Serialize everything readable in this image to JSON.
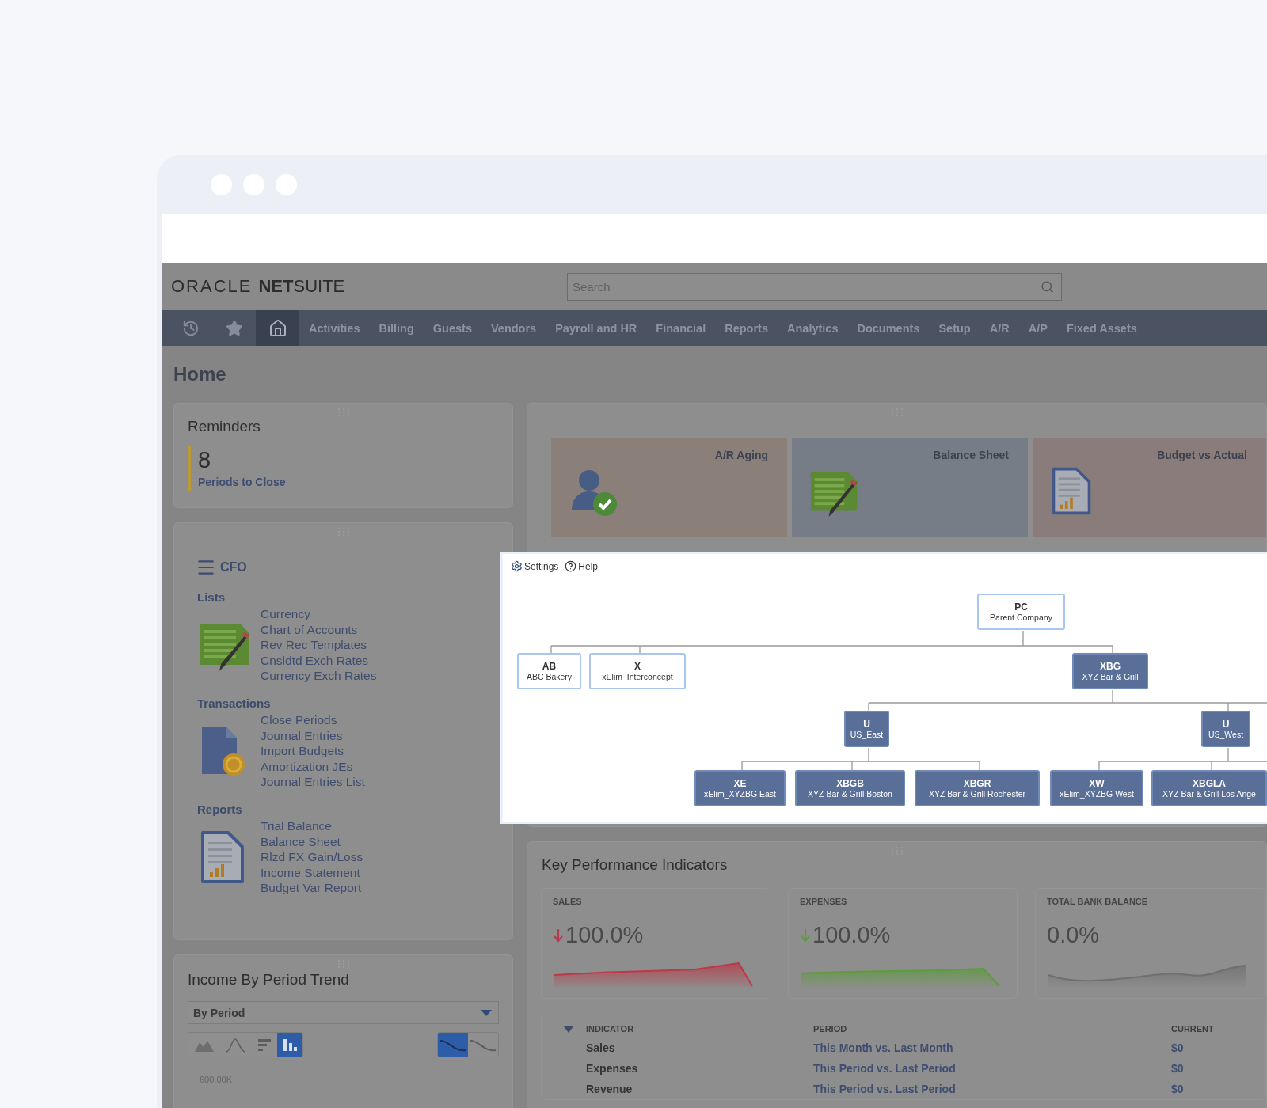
{
  "header": {
    "logo": {
      "brand": "ORACLE",
      "product": "**NET**SUITE"
    },
    "search": {
      "placeholder": "Search"
    }
  },
  "nav": {
    "shortcuts": [
      {
        "selected": false
      },
      {
        "selected": false
      },
      {
        "selected": true
      }
    ],
    "items": [
      {
        "label": "Activities",
        "selected": false
      },
      {
        "label": "Billing",
        "selected": false
      },
      {
        "label": "Guests",
        "selected": false
      },
      {
        "label": "Vendors",
        "selected": false
      },
      {
        "label": "Payroll and HR",
        "selected": false
      },
      {
        "label": "Financial",
        "selected": false
      },
      {
        "label": "Reports",
        "selected": false
      },
      {
        "label": "Analytics",
        "selected": false
      },
      {
        "label": "Documents",
        "selected": false
      },
      {
        "label": "Setup",
        "selected": false
      },
      {
        "label": "A/R",
        "selected": false
      },
      {
        "label": "A/P",
        "selected": false
      },
      {
        "label": "Fixed Assets",
        "selected": false
      }
    ]
  },
  "page_title": "Home",
  "reminders": {
    "title": "Reminders",
    "items": [
      {
        "count": "8",
        "label": "Periods to Close"
      }
    ]
  },
  "cfo": {
    "title": "CFO",
    "sections": [
      {
        "heading": "Lists",
        "links": [
          "Currency",
          "Chart of Accounts",
          "Rev Rec Templates",
          "Cnsldtd Exch Rates",
          "Currency Exch Rates"
        ]
      },
      {
        "heading": "Transactions",
        "links": [
          "Close Periods",
          "Journal Entries",
          "Import Budgets",
          "Amortization JEs",
          "Journal Entries List"
        ]
      },
      {
        "heading": "Reports",
        "links": [
          "Trial Balance",
          "Balance Sheet",
          "Rlzd FX Gain/Loss",
          "Income Statement",
          "Budget Var Report"
        ]
      }
    ]
  },
  "income_trend": {
    "title": "Income By Period Trend",
    "dropdown": "By Period",
    "chart_types": [
      {
        "selected": false
      },
      {
        "selected": false
      },
      {
        "selected": false
      },
      {
        "selected": true
      }
    ],
    "line_styles": [
      {
        "selected": true
      },
      {
        "selected": false
      }
    ],
    "axis_label": "600.00K"
  },
  "shortcut_tiles": [
    {
      "label": "A/R Aging",
      "color": "#8b7f79"
    },
    {
      "label": "Balance Sheet",
      "color": "#767d87"
    },
    {
      "label": "Budget vs Actual",
      "color": "#8b7c7c"
    }
  ],
  "org_chart": {
    "toolbar": [
      {
        "label": "Settings"
      },
      {
        "label": "Help"
      }
    ],
    "root": {
      "code": "PC",
      "name": "Parent Company",
      "kind": "outline",
      "children": [
        {
          "code": "AB",
          "name": "ABC Bakery",
          "kind": "outline"
        },
        {
          "code": "X",
          "name": "xElim_Interconcept",
          "kind": "outline"
        },
        {
          "code": "XBG",
          "name": "XYZ Bar & Grill",
          "kind": "filled",
          "children": [
            {
              "code": "U",
              "name": "US_East",
              "kind": "filled",
              "children": [
                {
                  "code": "XE",
                  "name": "xElim_XYZBG East",
                  "kind": "filled"
                },
                {
                  "code": "XBGB",
                  "name": "XYZ Bar & Grill Boston",
                  "kind": "filled"
                },
                {
                  "code": "XBGR",
                  "name": "XYZ Bar & Grill Rochester",
                  "kind": "filled"
                }
              ]
            },
            {
              "code": "U",
              "name": "US_West",
              "kind": "filled",
              "children": [
                {
                  "code": "XW",
                  "name": "xElim_XYZBG West",
                  "kind": "filled"
                },
                {
                  "code": "XBGLA",
                  "name": "XYZ Bar & Grill Los Ange",
                  "kind": "filled"
                }
              ]
            }
          ]
        }
      ]
    }
  },
  "kpi": {
    "title": "Key Performance Indicators",
    "cards": [
      {
        "label": "SALES",
        "value": "100.0%",
        "falling": true,
        "color": "#b93a48"
      },
      {
        "label": "EXPENSES",
        "value": "100.0%",
        "falling": true,
        "color": "#5f9a3e"
      },
      {
        "label": "TOTAL BANK BALANCE",
        "value": "0.0%",
        "falling": false,
        "color": "#6f6f6f"
      }
    ],
    "table": {
      "expanded": true,
      "columns": [
        "INDICATOR",
        "PERIOD",
        "CURRENT"
      ],
      "rows": [
        [
          "Sales",
          "This Month vs. Last Month",
          "$0"
        ],
        [
          "Expenses",
          "This Period vs. Last Period",
          "$0"
        ],
        [
          "Revenue",
          "This Period vs. Last Period",
          "$0"
        ]
      ]
    }
  }
}
